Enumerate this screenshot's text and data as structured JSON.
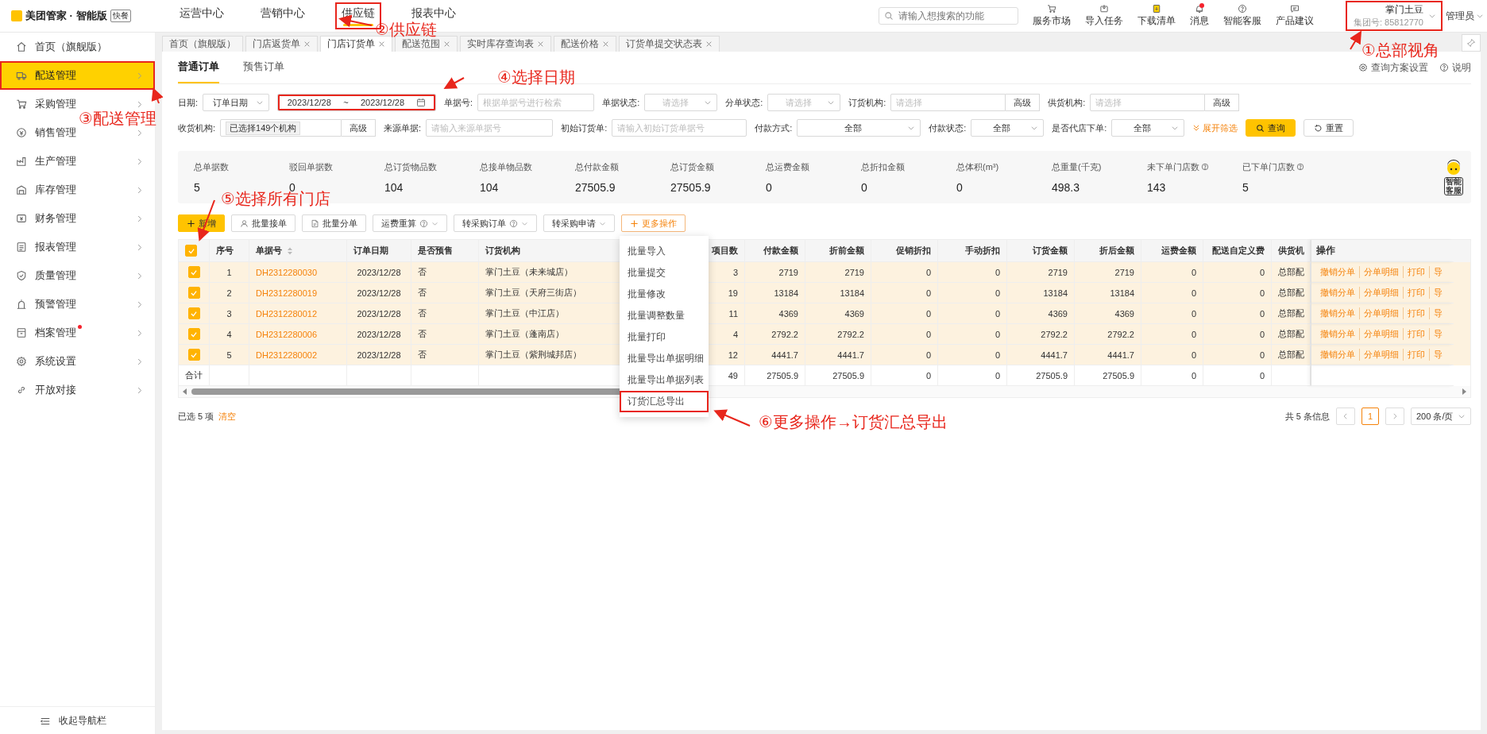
{
  "app": {
    "logo_text": "美团管家 · 智能版",
    "edition_badge": "快餐"
  },
  "top_nav": [
    {
      "label": "运营中心",
      "selected": false,
      "annotated": false
    },
    {
      "label": "营销中心",
      "selected": false,
      "annotated": false
    },
    {
      "label": "供应链",
      "selected": true,
      "annotated": true
    },
    {
      "label": "报表中心",
      "selected": false,
      "annotated": false
    }
  ],
  "search": {
    "placeholder": "请输入想搜索的功能"
  },
  "toolbar": [
    {
      "label": "服务市场",
      "dot": false
    },
    {
      "label": "导入任务",
      "dot": false
    },
    {
      "label": "下载清单",
      "dot": false
    },
    {
      "label": "消息",
      "dot": true
    },
    {
      "label": "智能客服",
      "dot": false
    },
    {
      "label": "产品建议",
      "dot": false
    }
  ],
  "account": {
    "name": "掌门土豆",
    "group_id": "集团号: 85812770",
    "annotated": true,
    "role": "管理员"
  },
  "sidebar": {
    "items": [
      {
        "label": "首页（旗舰版）",
        "selected": false,
        "dot": false,
        "expandable": false,
        "annotated": false
      },
      {
        "label": "配送管理",
        "selected": true,
        "dot": false,
        "expandable": true,
        "annotated": true
      },
      {
        "label": "采购管理",
        "selected": false,
        "dot": false,
        "expandable": true,
        "annotated": false
      },
      {
        "label": "销售管理",
        "selected": false,
        "dot": false,
        "expandable": true,
        "annotated": false
      },
      {
        "label": "生产管理",
        "selected": false,
        "dot": false,
        "expandable": true,
        "annotated": false
      },
      {
        "label": "库存管理",
        "selected": false,
        "dot": false,
        "expandable": true,
        "annotated": false
      },
      {
        "label": "财务管理",
        "selected": false,
        "dot": false,
        "expandable": true,
        "annotated": false
      },
      {
        "label": "报表管理",
        "selected": false,
        "dot": false,
        "expandable": true,
        "annotated": false
      },
      {
        "label": "质量管理",
        "selected": false,
        "dot": false,
        "expandable": true,
        "annotated": false
      },
      {
        "label": "预警管理",
        "selected": false,
        "dot": false,
        "expandable": true,
        "annotated": false
      },
      {
        "label": "档案管理",
        "selected": false,
        "dot": true,
        "expandable": true,
        "annotated": false
      },
      {
        "label": "系统设置",
        "selected": false,
        "dot": false,
        "expandable": true,
        "annotated": false
      },
      {
        "label": "开放对接",
        "selected": false,
        "dot": false,
        "expandable": true,
        "annotated": false
      }
    ],
    "collapse_label": "收起导航栏"
  },
  "page_tabs": [
    {
      "label": "首页（旗舰版）",
      "closable": false,
      "selected": false
    },
    {
      "label": "门店返货单",
      "closable": true,
      "selected": false
    },
    {
      "label": "门店订货单",
      "closable": true,
      "selected": true
    },
    {
      "label": "配送范围",
      "closable": true,
      "selected": false
    },
    {
      "label": "实时库存查询表",
      "closable": true,
      "selected": false
    },
    {
      "label": "配送价格",
      "closable": true,
      "selected": false
    },
    {
      "label": "订货单提交状态表",
      "closable": true,
      "selected": false
    }
  ],
  "order_tabs": [
    {
      "label": "普通订单",
      "selected": true
    },
    {
      "label": "预售订单",
      "selected": false
    }
  ],
  "header_links": [
    {
      "label": "查询方案设置"
    },
    {
      "label": "说明"
    }
  ],
  "filters": [
    [
      {
        "kind": "select",
        "label": "日期:",
        "value": "订单日期"
      },
      {
        "kind": "daterange",
        "start": "2023/12/28",
        "separator": "~",
        "end": "2023/12/28",
        "annotated": true
      },
      {
        "kind": "input",
        "label": "单据号:",
        "placeholder": "根据单据号进行检索"
      },
      {
        "kind": "select",
        "label": "单据状态:",
        "placeholder": "请选择"
      },
      {
        "kind": "select",
        "label": "分单状态:",
        "placeholder": "请选择"
      },
      {
        "kind": "picker",
        "label": "订货机构:",
        "placeholder": "请选择",
        "button": "高级"
      },
      {
        "kind": "picker",
        "label": "供货机构:",
        "placeholder": "请选择",
        "button": "高级"
      }
    ],
    [
      {
        "kind": "picker",
        "label": "收货机构:",
        "value": "已选择149个机构",
        "button": "高级"
      },
      {
        "kind": "input",
        "label": "来源单据:",
        "placeholder": "请输入来源单据号"
      },
      {
        "kind": "input",
        "label": "初始订货单:",
        "placeholder": "请输入初始订货单据号"
      },
      {
        "kind": "select",
        "label": "付款方式:",
        "value": "全部"
      },
      {
        "kind": "select",
        "label": "付款状态:",
        "value": "全部"
      },
      {
        "kind": "select",
        "label": "是否代店下单:",
        "value": "全部"
      }
    ]
  ],
  "filter_actions": {
    "expand": "展开筛选",
    "search": "查询",
    "reset": "重置"
  },
  "summary": [
    {
      "label": "总单据数",
      "value": "5",
      "help": false
    },
    {
      "label": "驳回单据数",
      "value": "0",
      "help": false
    },
    {
      "label": "总订货物品数",
      "value": "104",
      "help": false
    },
    {
      "label": "总接单物品数",
      "value": "104",
      "help": false
    },
    {
      "label": "总付款金额",
      "value": "27505.9",
      "help": false
    },
    {
      "label": "总订货金额",
      "value": "27505.9",
      "help": false
    },
    {
      "label": "总运费金额",
      "value": "0",
      "help": false
    },
    {
      "label": "总折扣金额",
      "value": "0",
      "help": false
    },
    {
      "label": "总体积(m³)",
      "value": "0",
      "help": false
    },
    {
      "label": "总重量(千克)",
      "value": "498.3",
      "help": false
    },
    {
      "label": "未下单门店数",
      "value": "143",
      "help": true
    },
    {
      "label": "已下单门店数",
      "value": "5",
      "help": true
    }
  ],
  "assistant_widget": {
    "label": "智能客服"
  },
  "actions": [
    {
      "label": "新增",
      "kind": "primary",
      "help": false,
      "caret": false
    },
    {
      "label": "批量接单",
      "kind": "user",
      "help": false,
      "caret": false
    },
    {
      "label": "批量分单",
      "kind": "doc",
      "help": false,
      "caret": false
    },
    {
      "label": "运费重算",
      "kind": "plain",
      "help": true,
      "caret": true
    },
    {
      "label": "转采购订单",
      "kind": "plain",
      "help": true,
      "caret": true
    },
    {
      "label": "转采购申请",
      "kind": "plain",
      "help": false,
      "caret": true
    },
    {
      "label": "更多操作",
      "kind": "more",
      "help": false,
      "caret": false
    }
  ],
  "more_menu": [
    {
      "label": "批量导入",
      "annotated": false
    },
    {
      "label": "批量提交",
      "annotated": false
    },
    {
      "label": "批量修改",
      "annotated": false
    },
    {
      "label": "批量调整数量",
      "annotated": false
    },
    {
      "label": "批量打印",
      "annotated": false
    },
    {
      "label": "批量导出单据明细",
      "annotated": false
    },
    {
      "label": "批量导出单据列表",
      "annotated": false
    },
    {
      "label": "订货汇总导出",
      "annotated": true
    }
  ],
  "table": {
    "all_selected": true,
    "columns": [
      {
        "label": "序号",
        "kind": "center",
        "sortable": false
      },
      {
        "label": "单据号",
        "kind": "link",
        "sortable": true
      },
      {
        "label": "订单日期",
        "kind": "center",
        "sortable": false
      },
      {
        "label": "是否预售",
        "kind": "text",
        "sortable": false
      },
      {
        "label": "订货机构",
        "kind": "text",
        "sortable": false
      },
      {
        "label": "项目数",
        "kind": "number",
        "sortable": false
      },
      {
        "label": "付款金额",
        "kind": "number",
        "sortable": false
      },
      {
        "label": "折前金额",
        "kind": "number",
        "sortable": false
      },
      {
        "label": "促销折扣",
        "kind": "number",
        "sortable": false
      },
      {
        "label": "手动折扣",
        "kind": "number",
        "sortable": false
      },
      {
        "label": "订货金额",
        "kind": "number",
        "sortable": false
      },
      {
        "label": "折后金额",
        "kind": "number",
        "sortable": false
      },
      {
        "label": "运费金额",
        "kind": "number",
        "sortable": false
      },
      {
        "label": "配送自定义费",
        "kind": "number",
        "sortable": false
      },
      {
        "label": "供货机",
        "kind": "text",
        "sortable": false
      }
    ],
    "ops_label": "操作",
    "rows": [
      {
        "selected": true,
        "cells": [
          "1",
          "DH2312280030",
          "2023/12/28",
          "否",
          "掌门土豆（未来城店）",
          "3",
          "2719",
          "2719",
          "0",
          "0",
          "2719",
          "2719",
          "0",
          "0",
          "总部配"
        ],
        "ops": [
          "撤销分单",
          "分单明细",
          "打印",
          "导"
        ]
      },
      {
        "selected": true,
        "cells": [
          "2",
          "DH2312280019",
          "2023/12/28",
          "否",
          "掌门土豆（天府三街店）",
          "19",
          "13184",
          "13184",
          "0",
          "0",
          "13184",
          "13184",
          "0",
          "0",
          "总部配"
        ],
        "ops": [
          "撤销分单",
          "分单明细",
          "打印",
          "导"
        ]
      },
      {
        "selected": true,
        "cells": [
          "3",
          "DH2312280012",
          "2023/12/28",
          "否",
          "掌门土豆（中江店）",
          "11",
          "4369",
          "4369",
          "0",
          "0",
          "4369",
          "4369",
          "0",
          "0",
          "总部配"
        ],
        "ops": [
          "撤销分单",
          "分单明细",
          "打印",
          "导"
        ]
      },
      {
        "selected": true,
        "cells": [
          "4",
          "DH2312280006",
          "2023/12/28",
          "否",
          "掌门土豆（蓬南店）",
          "4",
          "2792.2",
          "2792.2",
          "0",
          "0",
          "2792.2",
          "2792.2",
          "0",
          "0",
          "总部配"
        ],
        "ops": [
          "撤销分单",
          "分单明细",
          "打印",
          "导"
        ]
      },
      {
        "selected": true,
        "cells": [
          "5",
          "DH2312280002",
          "2023/12/28",
          "否",
          "掌门土豆（紫荆城邦店）",
          "12",
          "4441.7",
          "4441.7",
          "0",
          "0",
          "4441.7",
          "4441.7",
          "0",
          "0",
          "总部配"
        ],
        "ops": [
          "撤销分单",
          "分单明细",
          "打印",
          "导"
        ]
      }
    ],
    "total": {
      "label": "合计",
      "values": [
        "49",
        "27505.9",
        "27505.9",
        "0",
        "0",
        "27505.9",
        "27505.9",
        "0",
        "0"
      ]
    }
  },
  "selection": {
    "text": "已选 5 项",
    "clear": "清空"
  },
  "pagination": {
    "total": "共 5 条信息",
    "pages": [
      {
        "label": "1",
        "selected": true
      }
    ],
    "page_size": "200 条/页"
  },
  "annotations": [
    {
      "text": "①总部视角"
    },
    {
      "text": "②供应链"
    },
    {
      "text": "③配送管理"
    },
    {
      "text": "④选择日期"
    },
    {
      "text": "⑤选择所有门店"
    },
    {
      "text": "⑥更多操作→订货汇总导出"
    }
  ]
}
